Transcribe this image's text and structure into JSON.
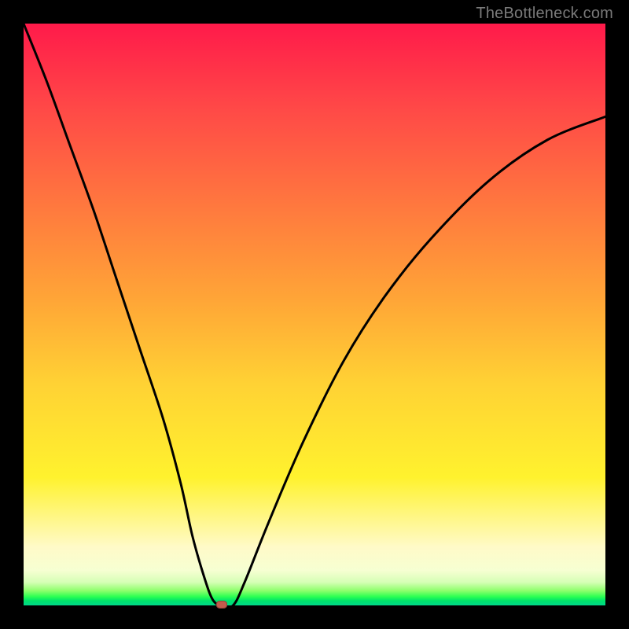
{
  "watermark": "TheBottleneck.com",
  "chart_data": {
    "type": "line",
    "title": "",
    "xlabel": "",
    "ylabel": "",
    "xlim": [
      0,
      100
    ],
    "ylim": [
      0,
      100
    ],
    "grid": false,
    "series": [
      {
        "name": "curve",
        "x": [
          0,
          4,
          8,
          12,
          16,
          20,
          24,
          27,
          29,
          31,
          32.5,
          34,
          36,
          38,
          42,
          48,
          55,
          62,
          70,
          80,
          90,
          100
        ],
        "y": [
          100,
          90,
          79,
          68,
          56,
          44,
          32,
          21,
          12,
          5,
          1,
          0,
          0,
          4,
          14,
          28,
          42,
          53,
          63,
          73,
          80,
          84
        ]
      }
    ],
    "marker": {
      "x": 34,
      "y": 0,
      "color": "#c45a4d"
    },
    "background_gradient_stops": [
      {
        "pos": 0.0,
        "color": "#ff1a4a"
      },
      {
        "pos": 0.15,
        "color": "#ff4a47"
      },
      {
        "pos": 0.32,
        "color": "#ff7a3e"
      },
      {
        "pos": 0.47,
        "color": "#ffa437"
      },
      {
        "pos": 0.62,
        "color": "#ffd234"
      },
      {
        "pos": 0.78,
        "color": "#fff22e"
      },
      {
        "pos": 0.9,
        "color": "#fffac8"
      },
      {
        "pos": 0.96,
        "color": "#d6ffb6"
      },
      {
        "pos": 0.985,
        "color": "#2cff52"
      },
      {
        "pos": 1.0,
        "color": "#00d88a"
      }
    ]
  }
}
